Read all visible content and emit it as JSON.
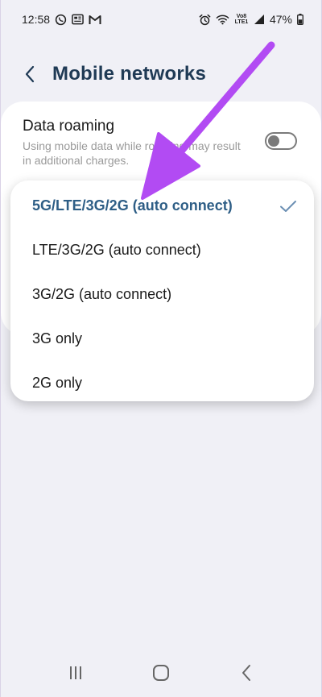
{
  "status_bar": {
    "time": "12:58",
    "lte_label": "Vo8 LTE1",
    "battery": "47%"
  },
  "header": {
    "title": "Mobile networks"
  },
  "data_roaming": {
    "title": "Data roaming",
    "description": "Using mobile data while roaming may result in additional charges.",
    "enabled": false
  },
  "network_mode": {
    "options": [
      {
        "label": "5G/LTE/3G/2G (auto connect)",
        "selected": true
      },
      {
        "label": "LTE/3G/2G (auto connect)",
        "selected": false
      },
      {
        "label": "3G/2G (auto connect)",
        "selected": false
      },
      {
        "label": "3G only",
        "selected": false
      },
      {
        "label": "2G only",
        "selected": false
      }
    ]
  },
  "colors": {
    "background": "#f0f0f6",
    "title": "#1f3a55",
    "selected_option": "#2e5e86",
    "check": "#6b8fb3",
    "annotation_arrow": "#b24bf3"
  },
  "icons": {
    "status_left": [
      "whatsapp-icon",
      "news-icon",
      "gmail-icon"
    ],
    "status_right": [
      "alarm-icon",
      "wifi-icon",
      "signal-icon",
      "battery-icon"
    ],
    "nav": [
      "recents-icon",
      "home-icon",
      "back-icon"
    ]
  }
}
